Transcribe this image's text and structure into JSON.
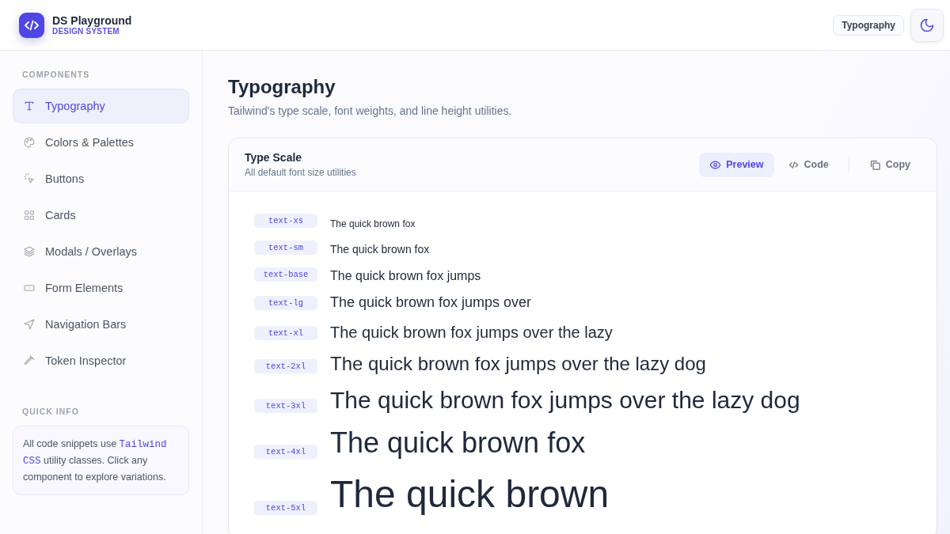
{
  "brand": {
    "name": "DS Playground",
    "tagline": "DESIGN SYSTEM"
  },
  "header": {
    "badge": "Typography"
  },
  "sidebar": {
    "section_title": "COMPONENTS",
    "items": [
      {
        "label": "Typography",
        "selected": true
      },
      {
        "label": "Colors & Palettes",
        "selected": false
      },
      {
        "label": "Buttons",
        "selected": false
      },
      {
        "label": "Cards",
        "selected": false
      },
      {
        "label": "Modals / Overlays",
        "selected": false
      },
      {
        "label": "Form Elements",
        "selected": false
      },
      {
        "label": "Navigation Bars",
        "selected": false
      },
      {
        "label": "Token Inspector",
        "selected": false
      }
    ],
    "info_title": "QUICK INFO",
    "info_text": "All code snippets use **Tailwind CSS** utility classes. Click any component to explore variations."
  },
  "page": {
    "title": "Typography",
    "subtitle": "Tailwind's type scale, font weights, and line height utilities."
  },
  "card": {
    "title": "Type Scale",
    "subtitle": "All default font size utilities",
    "tabs": [
      {
        "label": "Preview",
        "selected": true
      },
      {
        "label": "Code",
        "selected": false
      }
    ],
    "copy": "Copy",
    "rows": [
      {
        "kind": "xs",
        "token": "text-xs",
        "sample": "The quick brown fox"
      },
      {
        "kind": "sm",
        "token": "text-sm",
        "sample": "The quick brown fox"
      },
      {
        "kind": "base",
        "token": "text-base",
        "sample": "The quick brown fox jumps"
      },
      {
        "kind": "lg",
        "token": "text-lg",
        "sample": "The quick brown fox jumps over"
      },
      {
        "kind": "xl",
        "token": "text-xl",
        "sample": "The quick brown fox jumps over the lazy"
      },
      {
        "kind": "xxl",
        "token": "text-2xl",
        "sample": "The quick brown fox jumps over the lazy dog"
      },
      {
        "kind": "xxxl",
        "token": "text-3xl",
        "sample": "The quick brown fox jumps over the lazy dog"
      },
      {
        "kind": "xxxxl",
        "token": "text-4xl",
        "sample": "The quick brown fox"
      },
      {
        "kind": "xxxxxl",
        "token": "text-5xl",
        "sample": "The quick brown"
      }
    ]
  }
}
